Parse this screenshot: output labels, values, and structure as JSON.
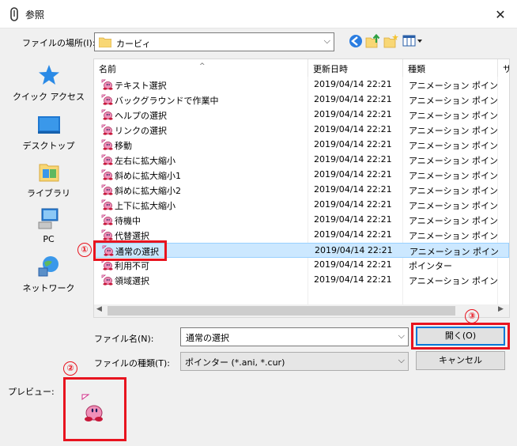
{
  "window": {
    "title": "参照",
    "close_glyph": "✕",
    "app_icon": "cursor-clip-icon"
  },
  "lookin": {
    "label": "ファイルの場所(I):",
    "value": "カービィ",
    "folder_icon": "folder-icon",
    "toolbar": [
      "back-icon",
      "up-folder-icon",
      "new-folder-icon",
      "view-menu-icon"
    ]
  },
  "places": [
    {
      "label": "クイック アクセス",
      "icon": "quick-access-star-icon"
    },
    {
      "label": "デスクトップ",
      "icon": "desktop-icon"
    },
    {
      "label": "ライブラリ",
      "icon": "library-icon"
    },
    {
      "label": "PC",
      "icon": "pc-icon"
    },
    {
      "label": "ネットワーク",
      "icon": "network-icon"
    }
  ],
  "columns": {
    "name": "名前",
    "date": "更新日時",
    "type": "種類",
    "extra": "サ"
  },
  "files": [
    {
      "name": "テキスト選択",
      "date": "2019/04/14 22:21",
      "type": "アニメーション ポイン..."
    },
    {
      "name": "バックグラウンドで作業中",
      "date": "2019/04/14 22:21",
      "type": "アニメーション ポイン..."
    },
    {
      "name": "ヘルプの選択",
      "date": "2019/04/14 22:21",
      "type": "アニメーション ポイン..."
    },
    {
      "name": "リンクの選択",
      "date": "2019/04/14 22:21",
      "type": "アニメーション ポイン..."
    },
    {
      "name": "移動",
      "date": "2019/04/14 22:21",
      "type": "アニメーション ポイン..."
    },
    {
      "name": "左右に拡大縮小",
      "date": "2019/04/14 22:21",
      "type": "アニメーション ポイン..."
    },
    {
      "name": "斜めに拡大縮小1",
      "date": "2019/04/14 22:21",
      "type": "アニメーション ポイン..."
    },
    {
      "name": "斜めに拡大縮小2",
      "date": "2019/04/14 22:21",
      "type": "アニメーション ポイン..."
    },
    {
      "name": "上下に拡大縮小",
      "date": "2019/04/14 22:21",
      "type": "アニメーション ポイン..."
    },
    {
      "name": "待機中",
      "date": "2019/04/14 22:21",
      "type": "アニメーション ポイン..."
    },
    {
      "name": "代替選択",
      "date": "2019/04/14 22:21",
      "type": "アニメーション ポイン..."
    },
    {
      "name": "通常の選択",
      "date": "2019/04/14 22:21",
      "type": "アニメーション ポイン...",
      "selected": true
    },
    {
      "name": "利用不可",
      "date": "2019/04/14 22:21",
      "type": "ポインター"
    },
    {
      "name": "領域選択",
      "date": "2019/04/14 22:21",
      "type": "アニメーション ポイン..."
    }
  ],
  "filename": {
    "label": "ファイル名(N):",
    "value": "通常の選択"
  },
  "filetype": {
    "label": "ファイルの種類(T):",
    "value": "ポインター (*.ani, *.cur)"
  },
  "buttons": {
    "open": "開く(O)",
    "cancel": "キャンセル"
  },
  "preview": {
    "label": "プレビュー:"
  },
  "annotations": {
    "n1": "①",
    "n2": "②",
    "n3": "③",
    "color": "#e8141f"
  },
  "colors": {
    "selection": "#cce8ff",
    "accent": "#0078d7",
    "kirby_pink": "#f090b8"
  }
}
